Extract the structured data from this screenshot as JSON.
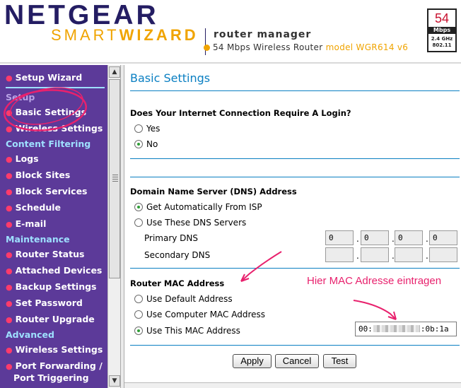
{
  "header": {
    "brand": "NETGEAR",
    "smart": "SMART",
    "wizard": "WIZARD",
    "title": "router manager",
    "subtitle": "54 Mbps Wireless Router",
    "model": "model WGR614 v6",
    "badge": {
      "speed": "54",
      "unit": "Mbps",
      "band": "2.4 GHz",
      "standard": "802.11"
    }
  },
  "sidebar": {
    "setup_wizard": "Setup Wizard",
    "section_setup": "Setup",
    "basic_settings": "Basic Settings",
    "wireless_settings_setup": "Wireless Settings",
    "section_content": "Content Filtering",
    "logs": "Logs",
    "block_sites": "Block Sites",
    "block_services": "Block Services",
    "schedule": "Schedule",
    "email": "E-mail",
    "section_maintenance": "Maintenance",
    "router_status": "Router Status",
    "attached_devices": "Attached Devices",
    "backup_settings": "Backup Settings",
    "set_password": "Set Password",
    "router_upgrade": "Router Upgrade",
    "section_advanced": "Advanced",
    "wireless_settings_adv": "Wireless Settings",
    "port_forwarding_1": "Port Forwarding /",
    "port_forwarding_2": "Port Triggering"
  },
  "main": {
    "title": "Basic Settings",
    "login_question": "Does Your Internet Connection Require A Login?",
    "login_yes": "Yes",
    "login_no": "No",
    "login_selected": "No",
    "dns_heading": "Domain Name Server (DNS) Address",
    "dns_auto": "Get Automatically From ISP",
    "dns_manual": "Use These DNS Servers",
    "dns_selected": "Get Automatically From ISP",
    "primary_dns_label": "Primary DNS",
    "primary_dns": [
      "0",
      "0",
      "0",
      "0"
    ],
    "secondary_dns_label": "Secondary DNS",
    "secondary_dns": [
      "",
      "",
      "",
      ""
    ],
    "mac_heading": "Router MAC Address",
    "mac_default": "Use Default Address",
    "mac_computer": "Use Computer MAC Address",
    "mac_this": "Use This MAC Address",
    "mac_selected": "Use This MAC Address",
    "mac_prefix": "00:",
    "mac_suffix": ":0b:1a",
    "apply": "Apply",
    "cancel": "Cancel",
    "test": "Test"
  },
  "annotation": {
    "text": "Hier MAC Adresse eintragen",
    "color": "#e8216d"
  },
  "colors": {
    "sidebar_bg": "#5c3a99",
    "section_text": "#9ee0ff",
    "title_blue": "#0a7fc2",
    "brand_navy": "#241d63",
    "brand_orange": "#f0a400"
  }
}
